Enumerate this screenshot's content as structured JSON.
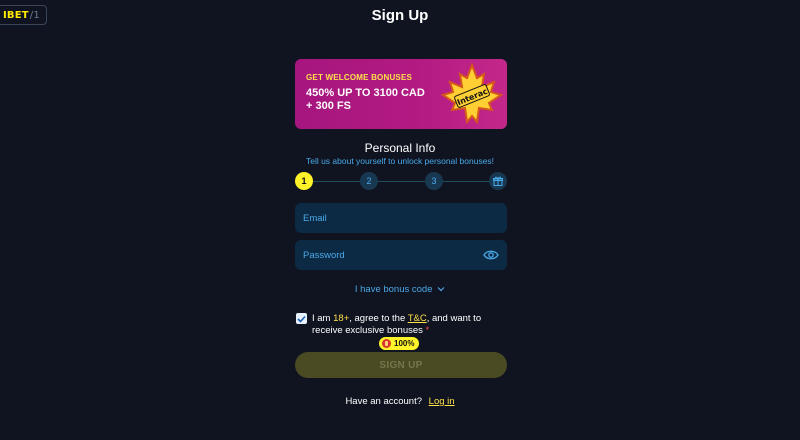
{
  "logo": {
    "text": "IBET",
    "suffix": "/1"
  },
  "page_title": "Sign Up",
  "banner": {
    "kicker": "GET WELCOME BONUSES",
    "headline_line1": "450% UP TO 3100 CAD",
    "headline_line2": "+ 300 FS",
    "art_label": "Interac",
    "colors": {
      "background": "#a5167e",
      "kicker": "#ffe14a",
      "leaf": "#ffcf33"
    }
  },
  "section": {
    "title": "Personal Info",
    "subtitle": "Tell us about yourself to unlock personal bonuses!"
  },
  "stepper": {
    "steps": [
      "1",
      "2",
      "3"
    ],
    "active_step": 1,
    "final_icon": "gift-icon"
  },
  "form": {
    "email_placeholder": "Email",
    "password_placeholder": "Password",
    "password_icon": "eye-icon",
    "bonus_code_label": "I have bonus code",
    "agree": {
      "checked": true,
      "prefix": "I am ",
      "age": "18+",
      "middle": ", agree to the ",
      "tc_label": "T&C",
      "suffix": ", and want to receive exclusive bonuses",
      "required_mark": "*"
    },
    "badge_label": "100%",
    "submit_label": "SIGN UP"
  },
  "footer": {
    "question": "Have an account?",
    "login_label": "Log in"
  },
  "colors": {
    "background": "#0f1420",
    "accent_yellow": "#fff32a",
    "link_blue": "#4aa8e8",
    "field_bg": "#0d2a44"
  }
}
